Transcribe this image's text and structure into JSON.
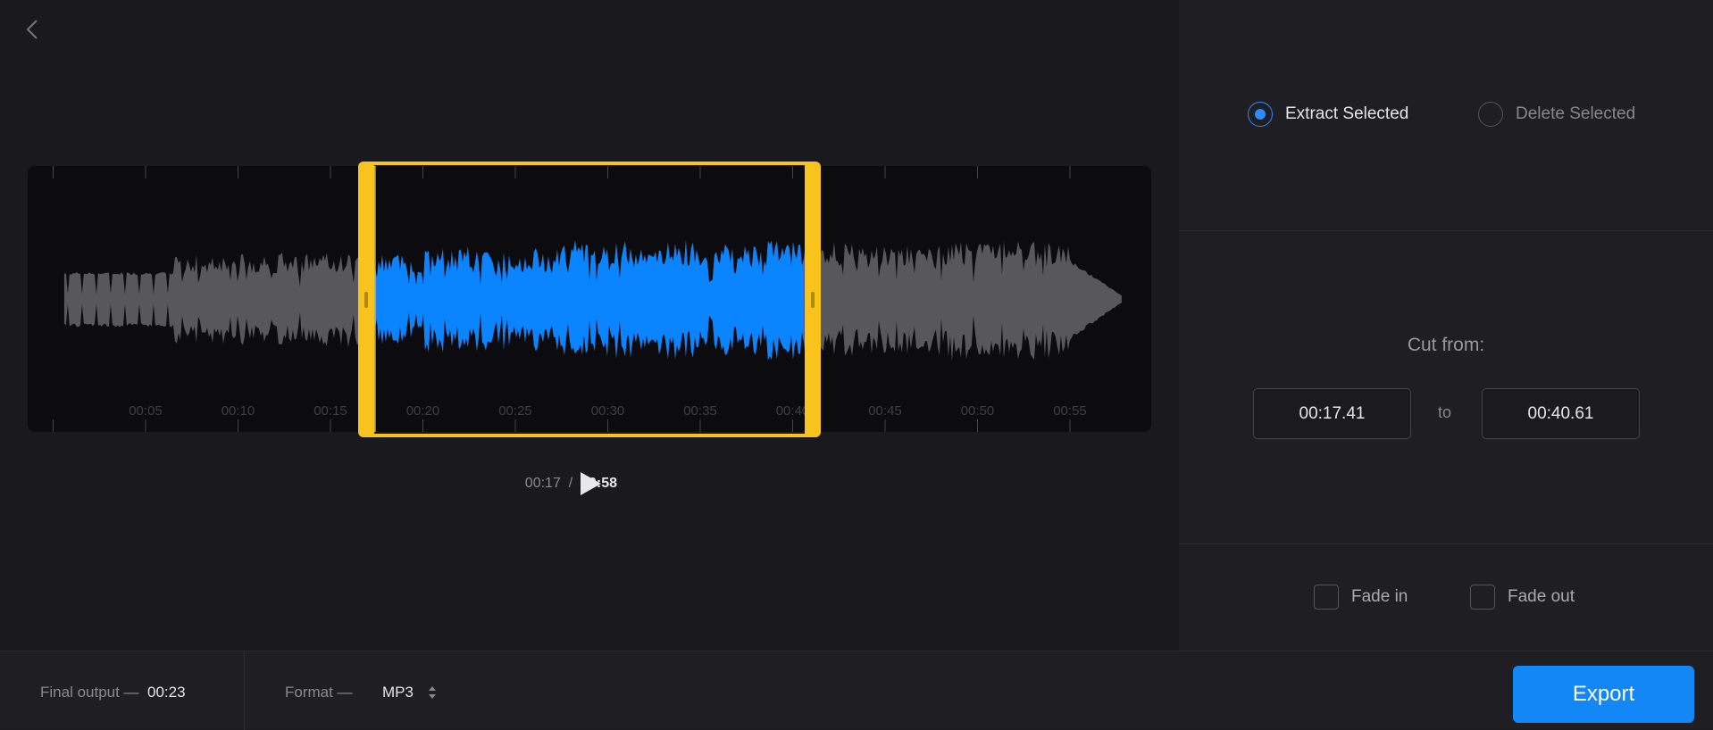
{
  "editor": {
    "duration_s": 58,
    "selection_start_s": 17.41,
    "selection_end_s": 40.61,
    "tick_labels": [
      "00:05",
      "00:10",
      "00:15",
      "00:20",
      "00:25",
      "00:30",
      "00:35",
      "00:40",
      "00:45",
      "00:50",
      "00:55"
    ],
    "current_time": "00:17",
    "separator": "/",
    "total_time": "00:58",
    "colors": {
      "selected_wave": "#0a84ff",
      "unselected_wave": "#58575c",
      "selection_frame": "#f8c31c"
    }
  },
  "panel": {
    "mode_options": [
      {
        "label": "Extract Selected",
        "selected": true
      },
      {
        "label": "Delete Selected",
        "selected": false
      }
    ],
    "cut_label": "Cut from:",
    "from_value": "00:17.41",
    "to_label": "to",
    "to_value": "00:40.61",
    "fade_in": {
      "label": "Fade in",
      "checked": false
    },
    "fade_out": {
      "label": "Fade out",
      "checked": false
    }
  },
  "footer": {
    "final_output_label": "Final output —",
    "final_output_value": "00:23",
    "format_label": "Format —",
    "format_value": "MP3",
    "export_label": "Export"
  }
}
